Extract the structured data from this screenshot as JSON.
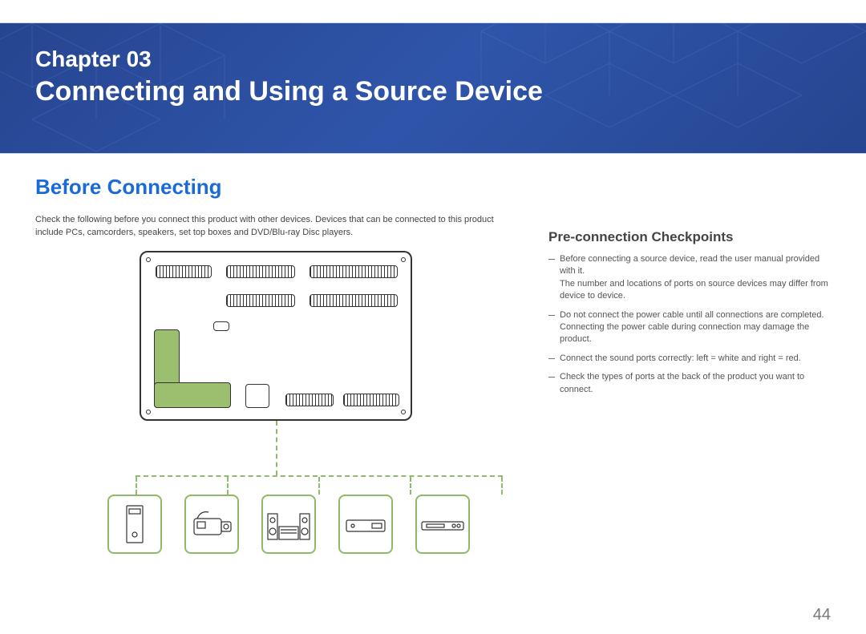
{
  "banner": {
    "chapter_label": "Chapter  03",
    "chapter_title": "Connecting and Using a Source Device"
  },
  "section": {
    "title": "Before Connecting",
    "intro": "Check the following before you connect this product with other devices. Devices that can be connected to this product include PCs, camcorders, speakers, set top boxes and DVD/Blu-ray Disc players."
  },
  "checkpoints": {
    "heading": "Pre-connection Checkpoints",
    "items": [
      {
        "line1": "Before connecting a source device, read the user manual provided with it.",
        "line2": "The number and locations of ports on source devices may differ from device to device."
      },
      {
        "line1": "Do not connect the power cable until all connections are completed.",
        "line2": "Connecting the power cable during connection may damage the product."
      },
      {
        "line1": "Connect the sound ports correctly: left = white and right = red.",
        "line2": ""
      },
      {
        "line1": "Check the types of ports at the back of the product you want to connect.",
        "line2": ""
      }
    ]
  },
  "devices": [
    {
      "name": "pc-tower"
    },
    {
      "name": "camcorder"
    },
    {
      "name": "speaker-system"
    },
    {
      "name": "set-top-box"
    },
    {
      "name": "disc-player"
    }
  ],
  "page_number": "44"
}
